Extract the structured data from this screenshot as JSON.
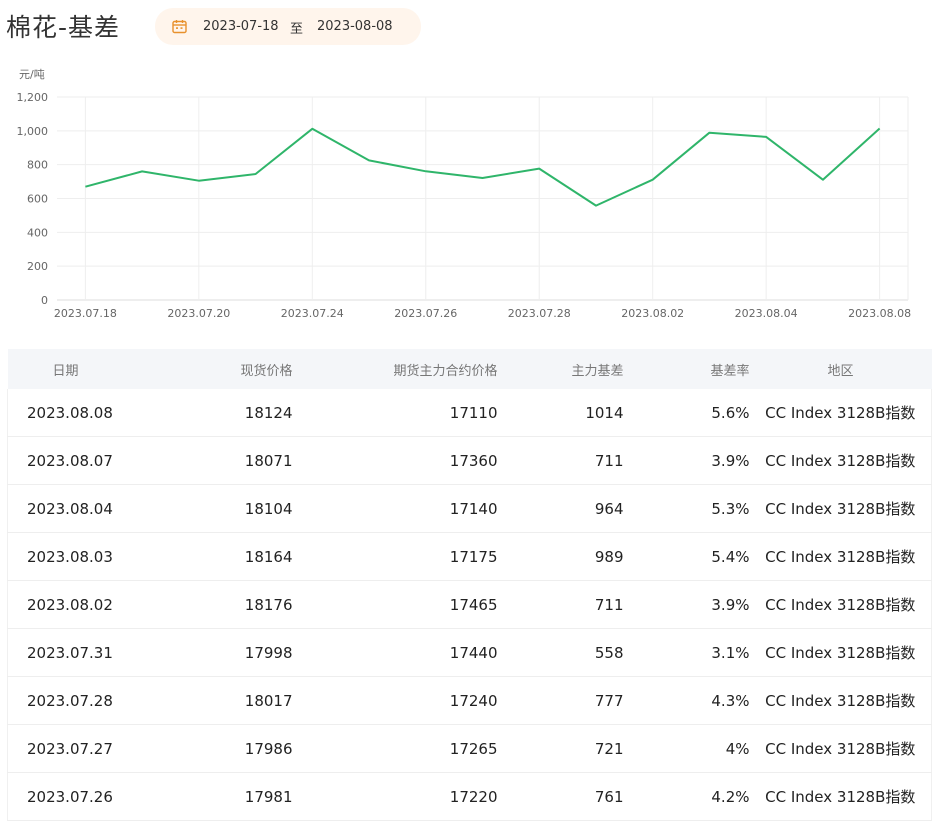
{
  "header": {
    "title": "棉花-基差",
    "date_from": "2023-07-18",
    "date_separator": "至",
    "date_to": "2023-08-08"
  },
  "chart_data": {
    "type": "line",
    "ylabel": "元/吨",
    "ylim": [
      0,
      1200
    ],
    "yticks": [
      "0",
      "200",
      "400",
      "600",
      "800",
      "1,000",
      "1,200"
    ],
    "x": [
      "2023.07.18",
      "2023.07.19",
      "2023.07.20",
      "2023.07.21",
      "2023.07.24",
      "2023.07.25",
      "2023.07.26",
      "2023.07.27",
      "2023.07.28",
      "2023.07.31",
      "2023.08.02",
      "2023.08.03",
      "2023.08.04",
      "2023.08.07",
      "2023.08.08"
    ],
    "xtick_labels": [
      "2023.07.18",
      "2023.07.20",
      "2023.07.24",
      "2023.07.26",
      "2023.07.28",
      "2023.08.02",
      "2023.08.04",
      "2023.08.08"
    ],
    "series": [
      {
        "values": [
          670,
          760,
          705,
          745,
          1012,
          825,
          761,
          721,
          777,
          558,
          711,
          989,
          964,
          711,
          1014
        ],
        "color": "#2fb56a"
      }
    ],
    "grid": true
  },
  "table": {
    "headers": {
      "date": "日期",
      "spot": "现货价格",
      "futures": "期货主力合约价格",
      "basis": "主力基差",
      "rate": "基差率",
      "region": "地区"
    },
    "rows": [
      {
        "date": "2023.08.08",
        "spot": "18124",
        "futures": "17110",
        "basis": "1014",
        "rate": "5.6%",
        "region": "CC Index 3128B指数"
      },
      {
        "date": "2023.08.07",
        "spot": "18071",
        "futures": "17360",
        "basis": "711",
        "rate": "3.9%",
        "region": "CC Index 3128B指数"
      },
      {
        "date": "2023.08.04",
        "spot": "18104",
        "futures": "17140",
        "basis": "964",
        "rate": "5.3%",
        "region": "CC Index 3128B指数"
      },
      {
        "date": "2023.08.03",
        "spot": "18164",
        "futures": "17175",
        "basis": "989",
        "rate": "5.4%",
        "region": "CC Index 3128B指数"
      },
      {
        "date": "2023.08.02",
        "spot": "18176",
        "futures": "17465",
        "basis": "711",
        "rate": "3.9%",
        "region": "CC Index 3128B指数"
      },
      {
        "date": "2023.07.31",
        "spot": "17998",
        "futures": "17440",
        "basis": "558",
        "rate": "3.1%",
        "region": "CC Index 3128B指数"
      },
      {
        "date": "2023.07.28",
        "spot": "18017",
        "futures": "17240",
        "basis": "777",
        "rate": "4.3%",
        "region": "CC Index 3128B指数"
      },
      {
        "date": "2023.07.27",
        "spot": "17986",
        "futures": "17265",
        "basis": "721",
        "rate": "4%",
        "region": "CC Index 3128B指数"
      },
      {
        "date": "2023.07.26",
        "spot": "17981",
        "futures": "17220",
        "basis": "761",
        "rate": "4.2%",
        "region": "CC Index 3128B指数"
      }
    ]
  },
  "colors": {
    "accent": "#e8912d",
    "date_range_bg": "#fff5ec",
    "line": "#2fb56a",
    "negative_red": "#d0332a",
    "header_bg": "#f4f6f9"
  },
  "icons": {
    "calendar": "calendar-icon"
  }
}
